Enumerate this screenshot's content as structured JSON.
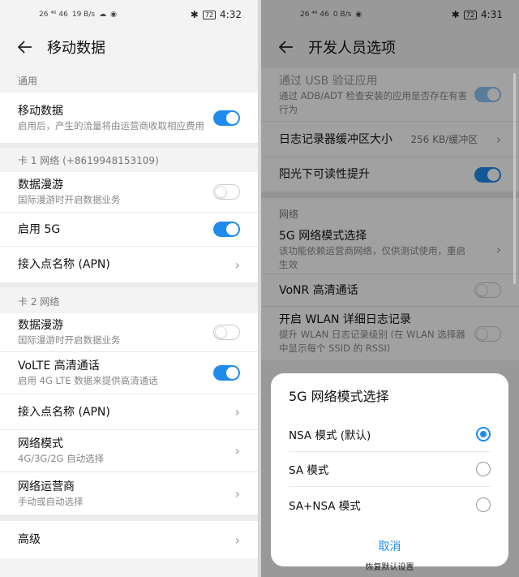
{
  "left": {
    "status": {
      "signal_text": "26 ⁴⁶ 46",
      "rate": "19 B/s",
      "battery": "72",
      "time": "4:32"
    },
    "title": "移动数据",
    "general_label": "通用",
    "mobile_data": {
      "title": "移动数据",
      "subtitle": "启用后，产生的流量将由运营商收取相应费用"
    },
    "sim1_label": "卡 1 网络 (+8619948153109)",
    "sim1": {
      "roaming": {
        "title": "数据漫游",
        "subtitle": "国际漫游时开启数据业务"
      },
      "enable5g": {
        "title": "启用 5G"
      },
      "apn": {
        "title": "接入点名称 (APN)"
      }
    },
    "sim2_label": "卡 2 网络",
    "sim2": {
      "roaming": {
        "title": "数据漫游",
        "subtitle": "国际漫游时开启数据业务"
      },
      "volte": {
        "title": "VoLTE 高清通话",
        "subtitle": "启用 4G LTE 数据来提供高清通话"
      },
      "apn": {
        "title": "接入点名称 (APN)"
      },
      "network_mode": {
        "title": "网络模式",
        "subtitle": "4G/3G/2G 自动选择"
      },
      "operator": {
        "title": "网络运营商",
        "subtitle": "手动或自动选择"
      }
    },
    "advanced": {
      "title": "高级"
    }
  },
  "right": {
    "status": {
      "signal_text": "26 ⁴⁶ 46",
      "rate": "0 B/s",
      "battery": "72",
      "time": "4:31"
    },
    "title": "开发人员选项",
    "usb_verify": {
      "title": "通过 USB 验证应用",
      "subtitle": "通过 ADB/ADT 检查安装的应用是否存在有害行为"
    },
    "log_buffer": {
      "title": "日志记录器缓冲区大小",
      "value": "256 KB/缓冲区"
    },
    "sunlight": {
      "title": "阳光下可读性提升"
    },
    "network_label": "网络",
    "mode5g": {
      "title": "5G 网络模式选择",
      "subtitle": "该功能依赖运营商网络，仅供测试使用，重启生效"
    },
    "vonr": {
      "title": "VoNR 高清通话"
    },
    "wlan_log": {
      "title": "开启 WLAN 详细日志记录",
      "subtitle": "提升 WLAN 日志记录级别 (在 WLAN 选择器中显示每个 SSID 的 RSSI)"
    },
    "below_dialog": "恢复默认设置"
  },
  "dialog": {
    "title": "5G 网络模式选择",
    "options": [
      "NSA 模式 (默认)",
      "SA 模式",
      "SA+NSA 模式"
    ],
    "selected_index": 0,
    "cancel": "取消"
  },
  "colors": {
    "accent": "#1f8ceb"
  }
}
